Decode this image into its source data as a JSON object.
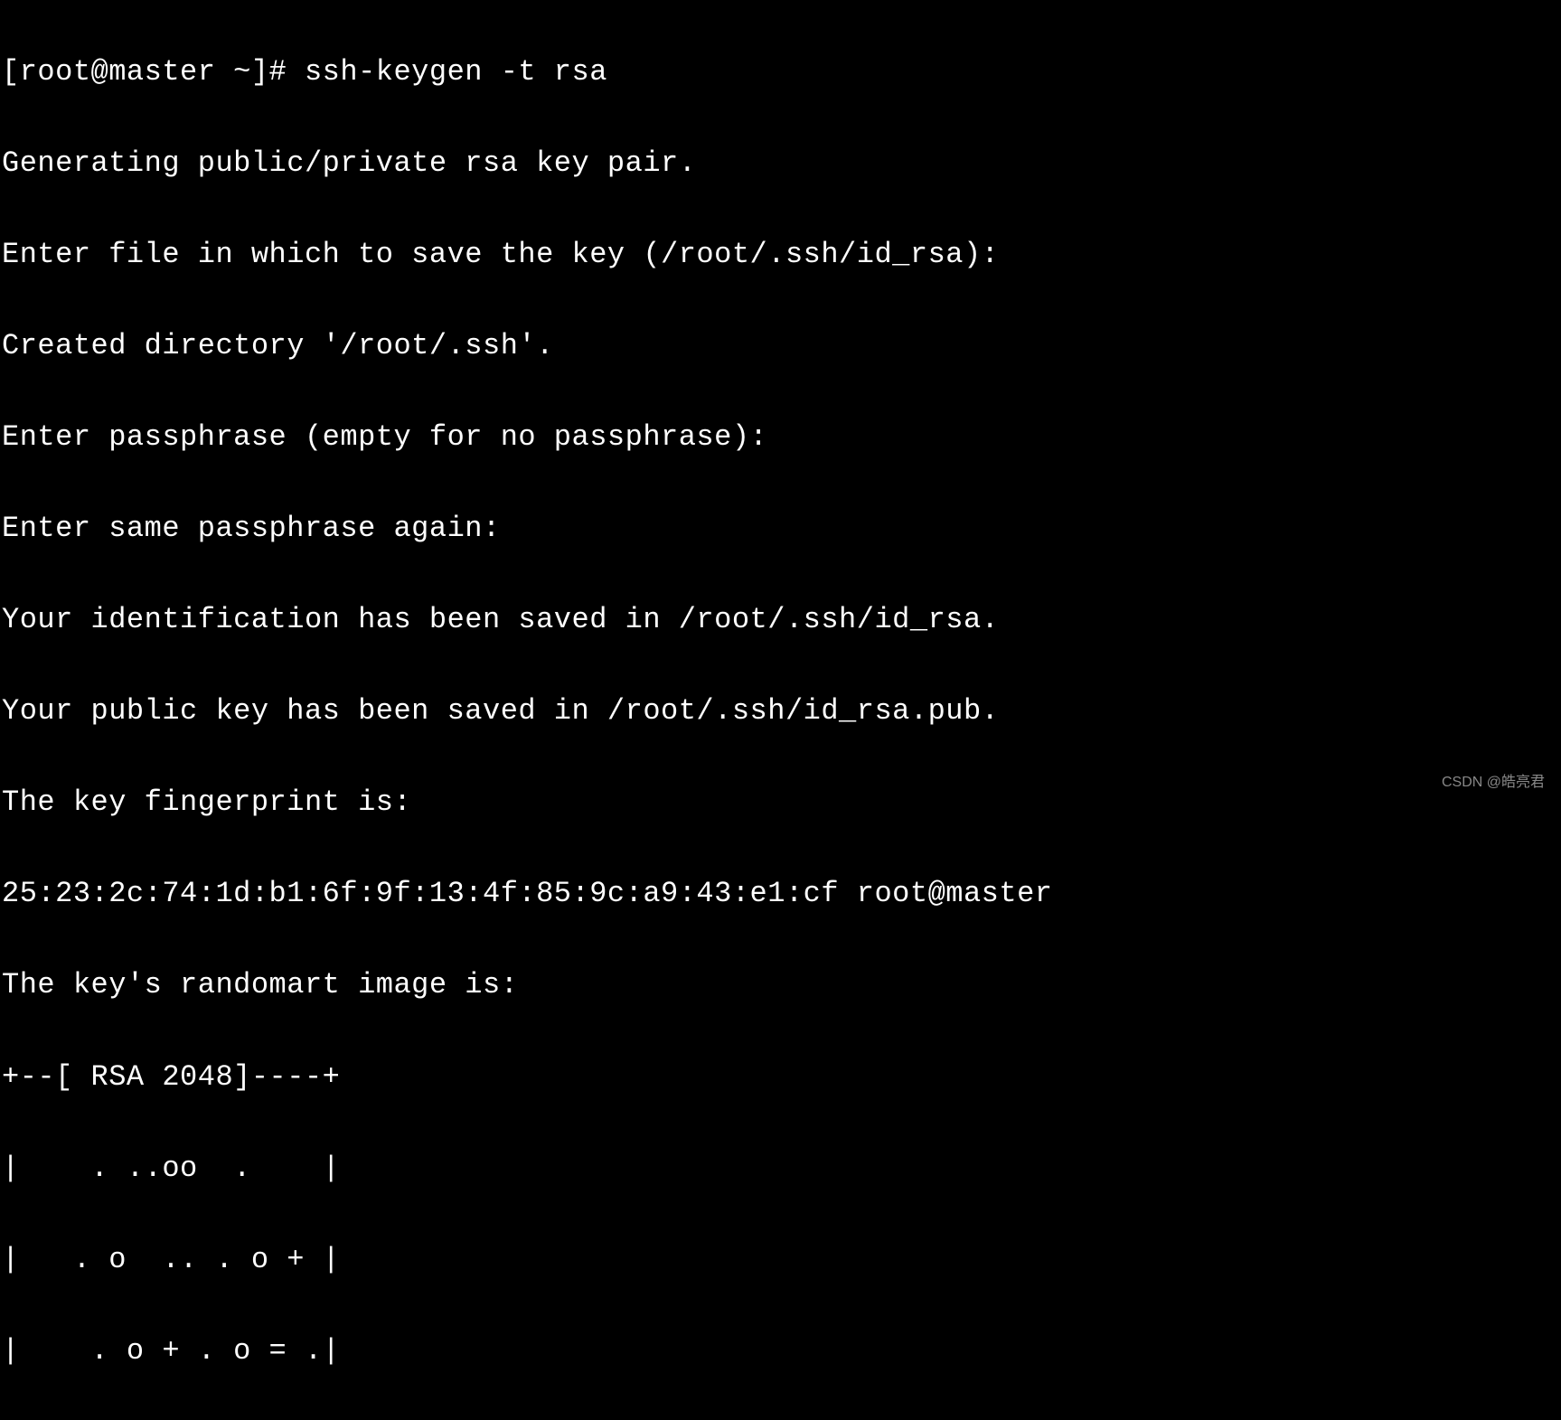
{
  "terminal": {
    "prompt": "[root@master ~]# ",
    "command": "ssh-keygen -t rsa",
    "lines": [
      "Generating public/private rsa key pair.",
      "Enter file in which to save the key (/root/.ssh/id_rsa):",
      "Created directory '/root/.ssh'.",
      "Enter passphrase (empty for no passphrase):",
      "Enter same passphrase again:",
      "Your identification has been saved in /root/.ssh/id_rsa.",
      "Your public key has been saved in /root/.ssh/id_rsa.pub.",
      "The key fingerprint is:",
      "25:23:2c:74:1d:b1:6f:9f:13:4f:85:9c:a9:43:e1:cf root@master",
      "The key's randomart image is:",
      "+--[ RSA 2048]----+",
      "|    . ..oo  .    |",
      "|   . o  .. . o + |",
      "|    . o + . o = .|"
    ]
  },
  "watermark": "CSDN @皓亮君"
}
